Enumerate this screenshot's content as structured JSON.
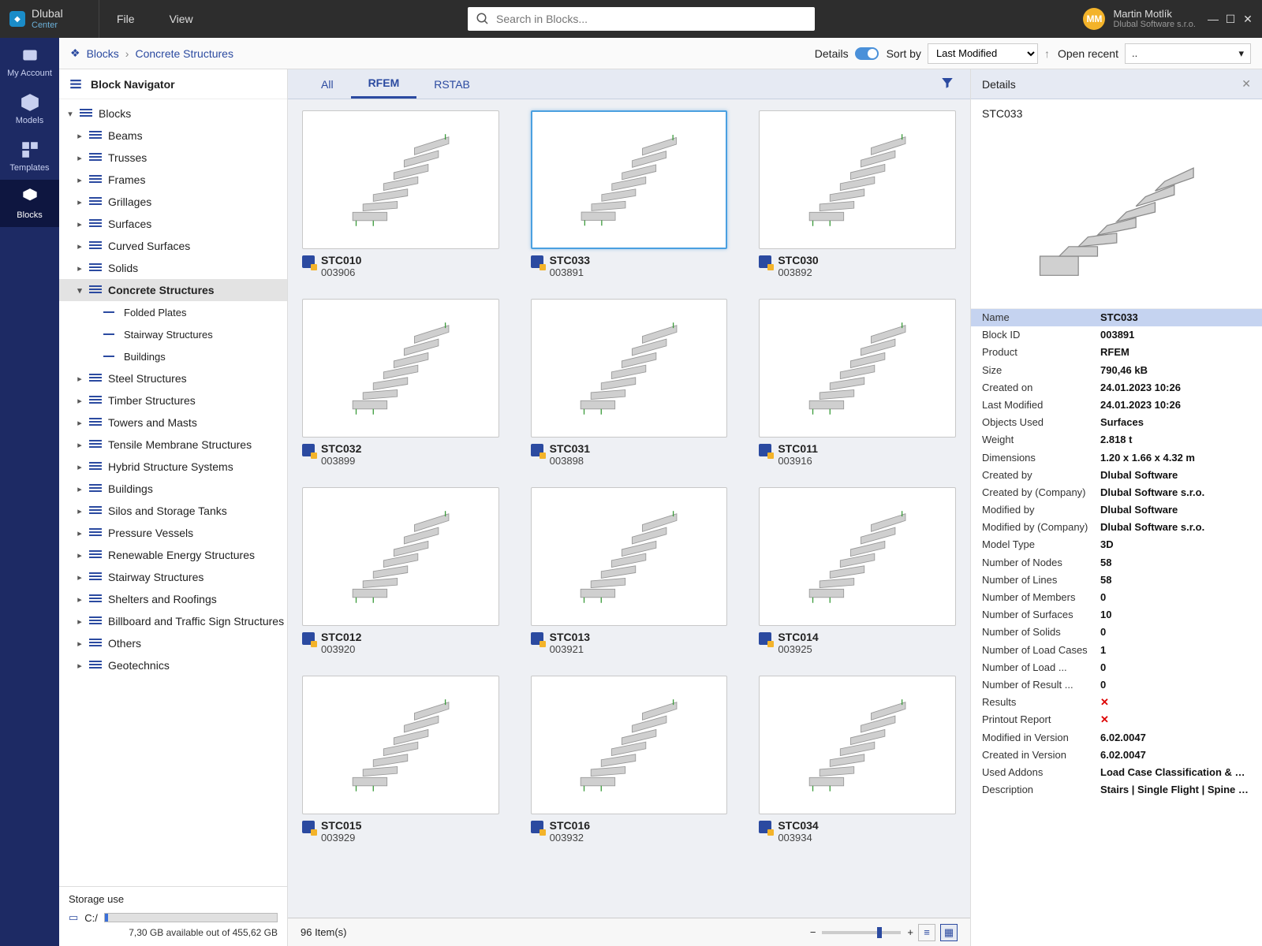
{
  "brand": {
    "name": "Dlubal",
    "sub": "Center"
  },
  "menu": [
    "File",
    "View"
  ],
  "search_placeholder": "Search in Blocks...",
  "user": {
    "initials": "MM",
    "name": "Martin Motlík",
    "company": "Dlubal Software s.r.o."
  },
  "sidenav": [
    {
      "label": "My Account"
    },
    {
      "label": "Models"
    },
    {
      "label": "Templates"
    },
    {
      "label": "Blocks"
    }
  ],
  "breadcrumb": [
    "Blocks",
    "Concrete Structures"
  ],
  "toolbar": {
    "details_label": "Details",
    "sortby_label": "Sort by",
    "sort_value": "Last Modified",
    "open_recent_label": "Open recent",
    "open_recent_value": ".."
  },
  "navigator": {
    "title": "Block Navigator",
    "root": "Blocks",
    "items": [
      {
        "label": "Beams"
      },
      {
        "label": "Trusses"
      },
      {
        "label": "Frames"
      },
      {
        "label": "Grillages"
      },
      {
        "label": "Surfaces"
      },
      {
        "label": "Curved Surfaces"
      },
      {
        "label": "Solids"
      },
      {
        "label": "Concrete Structures",
        "sel": true,
        "children": [
          "Folded Plates",
          "Stairway Structures",
          "Buildings"
        ]
      },
      {
        "label": "Steel Structures"
      },
      {
        "label": "Timber Structures"
      },
      {
        "label": "Towers and Masts"
      },
      {
        "label": "Tensile Membrane Structures"
      },
      {
        "label": "Hybrid Structure Systems"
      },
      {
        "label": "Buildings"
      },
      {
        "label": "Silos and Storage Tanks"
      },
      {
        "label": "Pressure Vessels"
      },
      {
        "label": "Renewable Energy Structures"
      },
      {
        "label": "Stairway Structures"
      },
      {
        "label": "Shelters and Roofings"
      },
      {
        "label": "Billboard and Traffic Sign Structures"
      },
      {
        "label": "Others"
      },
      {
        "label": "Geotechnics"
      }
    ]
  },
  "storage": {
    "title": "Storage use",
    "drive": "C:/",
    "text": "7,30 GB available out of 455,62 GB"
  },
  "tabs": [
    "All",
    "RFEM",
    "RSTAB"
  ],
  "active_tab": 1,
  "cards": [
    {
      "name": "STC010",
      "id": "003906"
    },
    {
      "name": "STC033",
      "id": "003891",
      "sel": true
    },
    {
      "name": "STC030",
      "id": "003892"
    },
    {
      "name": "STC032",
      "id": "003899"
    },
    {
      "name": "STC031",
      "id": "003898"
    },
    {
      "name": "STC011",
      "id": "003916"
    },
    {
      "name": "STC012",
      "id": "003920"
    },
    {
      "name": "STC013",
      "id": "003921"
    },
    {
      "name": "STC014",
      "id": "003925"
    },
    {
      "name": "STC015",
      "id": "003929"
    },
    {
      "name": "STC016",
      "id": "003932"
    },
    {
      "name": "STC034",
      "id": "003934"
    }
  ],
  "footer": {
    "count": "96 Item(s)"
  },
  "details": {
    "panel_title": "Details",
    "title": "STC033",
    "rows": [
      {
        "k": "Name",
        "v": "STC033",
        "hi": true
      },
      {
        "k": "Block ID",
        "v": "003891"
      },
      {
        "k": "Product",
        "v": "RFEM"
      },
      {
        "k": "Size",
        "v": "790,46 kB"
      },
      {
        "k": "Created on",
        "v": "24.01.2023 10:26"
      },
      {
        "k": "Last Modified",
        "v": "24.01.2023 10:26"
      },
      {
        "k": "Objects Used",
        "v": "Surfaces"
      },
      {
        "k": "Weight",
        "v": "2.818 t"
      },
      {
        "k": "Dimensions",
        "v": "1.20 x 1.66 x 4.32 m"
      },
      {
        "k": "Created by",
        "v": "Dlubal Software"
      },
      {
        "k": "Created by (Company)",
        "v": "Dlubal Software s.r.o."
      },
      {
        "k": "Modified by",
        "v": "Dlubal Software"
      },
      {
        "k": "Modified by (Company)",
        "v": "Dlubal Software s.r.o."
      },
      {
        "k": "Model Type",
        "v": "3D"
      },
      {
        "k": "Number of Nodes",
        "v": "58"
      },
      {
        "k": "Number of Lines",
        "v": "58"
      },
      {
        "k": "Number of Members",
        "v": "0"
      },
      {
        "k": "Number of Surfaces",
        "v": "10"
      },
      {
        "k": "Number of Solids",
        "v": "0"
      },
      {
        "k": "Number of Load Cases",
        "v": "1"
      },
      {
        "k": "Number of Load ...",
        "v": "0"
      },
      {
        "k": "Number of Result ...",
        "v": "0"
      },
      {
        "k": "Results",
        "v": "✕",
        "red": true
      },
      {
        "k": "Printout Report",
        "v": "✕",
        "red": true
      },
      {
        "k": "Modified in Version",
        "v": "6.02.0047"
      },
      {
        "k": "Created in Version",
        "v": "6.02.0047"
      },
      {
        "k": "Used Addons",
        "v": "Load Case Classification & Combination ..."
      },
      {
        "k": "Description",
        "v": "Stairs | Single Flight | Spine Beam With ..."
      }
    ]
  }
}
